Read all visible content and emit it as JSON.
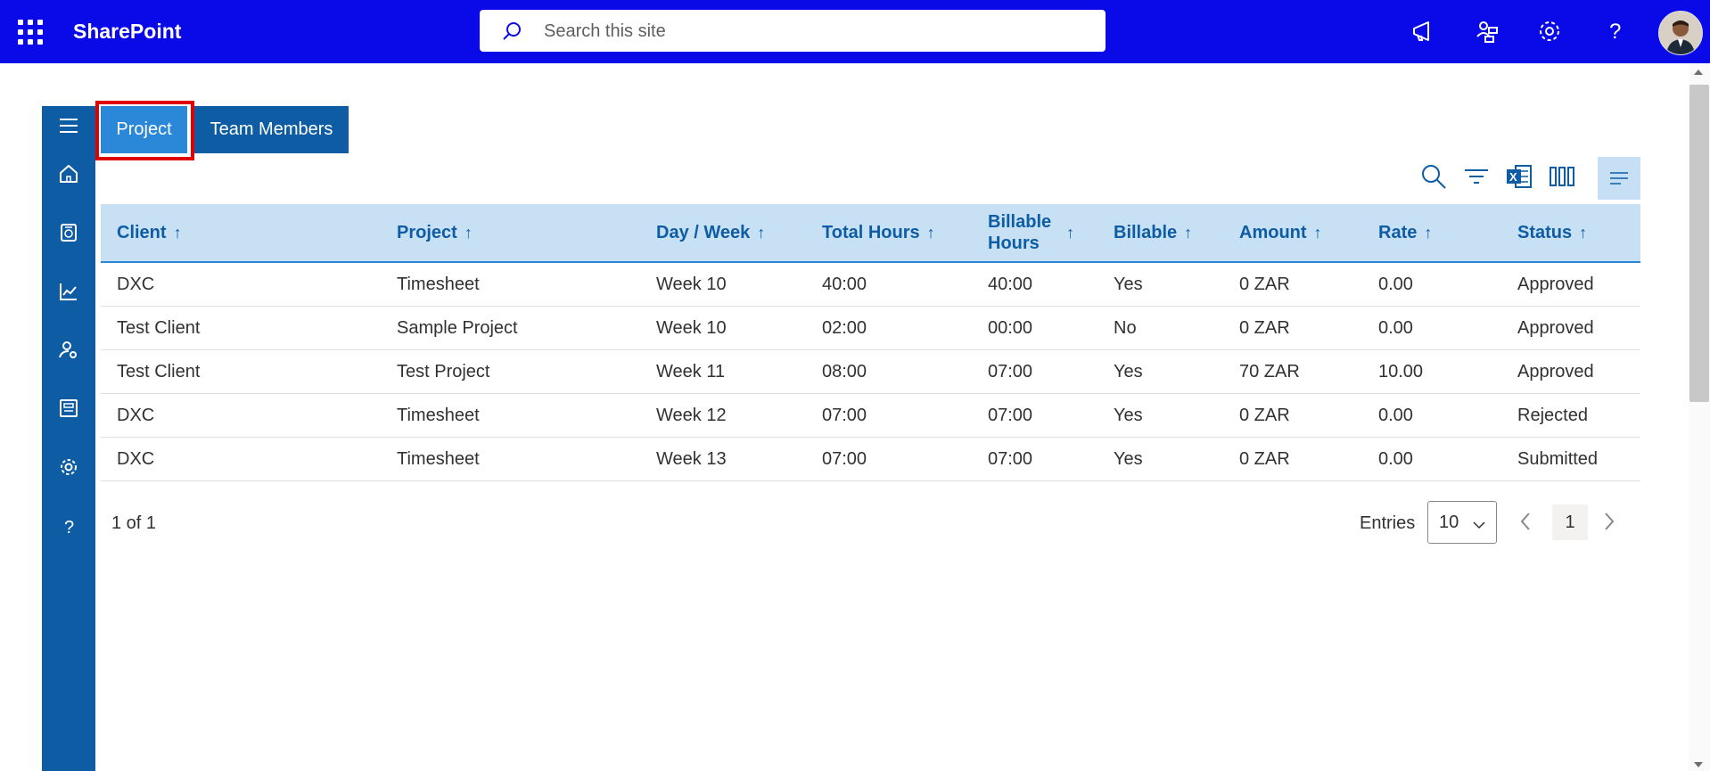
{
  "app": {
    "brand": "SharePoint",
    "search_placeholder": "Search this site"
  },
  "topbar_icons": [
    "megaphone-icon",
    "people-switch-icon",
    "gear-icon",
    "help-icon"
  ],
  "nav_icons": [
    "hamburger-icon",
    "home-icon",
    "calculator-icon",
    "chart-line-icon",
    "user-settings-icon",
    "dashboard-icon",
    "gear-icon",
    "help-icon"
  ],
  "tabs": [
    {
      "label": "Project",
      "active": true
    },
    {
      "label": "Team Members",
      "active": false
    }
  ],
  "toolbar": [
    "search-icon",
    "filter-icon",
    "excel-export-icon",
    "columns-icon",
    "align-icon"
  ],
  "table": {
    "columns": [
      "Client",
      "Project",
      "Day / Week",
      "Total Hours",
      "Billable Hours",
      "Billable",
      "Amount",
      "Rate",
      "Status"
    ],
    "sort_glyph": "↑",
    "rows": [
      [
        "DXC",
        "Timesheet",
        "Week 10",
        "40:00",
        "40:00",
        "Yes",
        "0 ZAR",
        "0.00",
        "Approved"
      ],
      [
        "Test Client",
        "Sample Project",
        "Week 10",
        "02:00",
        "00:00",
        "No",
        "0 ZAR",
        "0.00",
        "Approved"
      ],
      [
        "Test Client",
        "Test Project",
        "Week 11",
        "08:00",
        "07:00",
        "Yes",
        "70 ZAR",
        "10.00",
        "Approved"
      ],
      [
        "DXC",
        "Timesheet",
        "Week 12",
        "07:00",
        "07:00",
        "Yes",
        "0 ZAR",
        "0.00",
        "Rejected"
      ],
      [
        "DXC",
        "Timesheet",
        "Week 13",
        "07:00",
        "07:00",
        "Yes",
        "0 ZAR",
        "0.00",
        "Submitted"
      ]
    ]
  },
  "footer": {
    "page_count": "1 of 1",
    "entries_label": "Entries",
    "entries_value": "10",
    "current_page": "1"
  },
  "colors": {
    "topbar": "#0a0ae8",
    "nav": "#0e5da4",
    "active_tab": "#2b88d8",
    "header_bg": "#c7e0f4",
    "highlight": "#e00000"
  }
}
